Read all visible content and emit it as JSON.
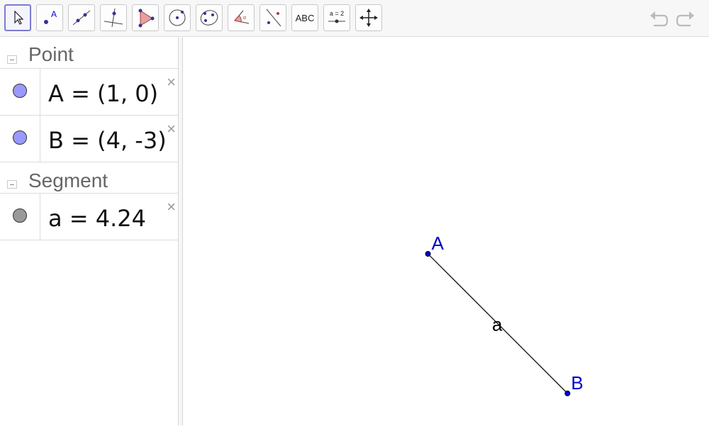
{
  "toolbar": {
    "tools": [
      {
        "name": "move-tool",
        "icon": "cursor-icon",
        "selected": true
      },
      {
        "name": "point-tool",
        "icon": "point-icon",
        "label": "A"
      },
      {
        "name": "line-tool",
        "icon": "line-icon"
      },
      {
        "name": "perpendicular-line-tool",
        "icon": "perpendicular-icon"
      },
      {
        "name": "polygon-tool",
        "icon": "polygon-icon"
      },
      {
        "name": "circle-tool",
        "icon": "circle-center-icon"
      },
      {
        "name": "conic-tool",
        "icon": "ellipse-icon"
      },
      {
        "name": "angle-tool",
        "icon": "angle-icon"
      },
      {
        "name": "reflect-tool",
        "icon": "reflect-icon"
      },
      {
        "name": "text-tool",
        "icon": "text-icon",
        "label": "ABC"
      },
      {
        "name": "slider-tool",
        "icon": "slider-icon",
        "label": "a = 2"
      },
      {
        "name": "move-graphics-tool",
        "icon": "move-graphics-icon"
      }
    ],
    "undo_icon": "undo-icon",
    "redo_icon": "redo-icon"
  },
  "algebra": {
    "categories": [
      {
        "title": "Point",
        "items": [
          {
            "text": "A = (1, 0)",
            "color": "#9999ff"
          },
          {
            "text": "B = (4, -3)",
            "color": "#9999ff"
          }
        ]
      },
      {
        "title": "Segment",
        "items": [
          {
            "text": "a = 4.24",
            "color": "#999999"
          }
        ]
      }
    ],
    "delete_glyph": "×"
  },
  "graphics": {
    "points": [
      {
        "label": "A",
        "x": 1,
        "y": 0,
        "color": "#0000cc"
      },
      {
        "label": "B",
        "x": 4,
        "y": -3,
        "color": "#0000cc"
      }
    ],
    "segments": [
      {
        "label": "a",
        "from": "A",
        "to": "B",
        "color": "#000000"
      }
    ]
  },
  "colors": {
    "point_color": "#0000cc",
    "segment_color": "#000000",
    "selected_tool_border": "#7b7bd0"
  }
}
